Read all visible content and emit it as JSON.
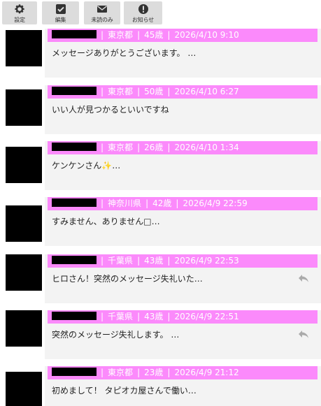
{
  "toolbar": {
    "settings_label": "設定",
    "edit_label": "編集",
    "unread_label": "未読のみ",
    "notice_label": "お知らせ"
  },
  "messages": [
    {
      "prefecture": "東京都",
      "age": "45歳",
      "datetime": "2026/4/10 9:10",
      "preview": "メッセージありがとうございます。 …",
      "reply": false
    },
    {
      "prefecture": "東京都",
      "age": "50歳",
      "datetime": "2026/4/10 6:27",
      "preview": "いい人が見つかるといいですね",
      "reply": false
    },
    {
      "prefecture": "東京都",
      "age": "26歳",
      "datetime": "2026/4/10 1:34",
      "preview": "ケンケンさん✨…",
      "reply": false
    },
    {
      "prefecture": "神奈川県",
      "age": "42歳",
      "datetime": "2026/4/9 22:59",
      "preview": "すみません、ありません□…",
      "reply": false
    },
    {
      "prefecture": "千葉県",
      "age": "43歳",
      "datetime": "2026/4/9 22:53",
      "preview": "ヒロさん！突然のメッセージ失礼いた…",
      "reply": true
    },
    {
      "prefecture": "千葉県",
      "age": "43歳",
      "datetime": "2026/4/9 22:51",
      "preview": "突然のメッセージ失礼します。 …",
      "reply": true
    },
    {
      "prefecture": "東京都",
      "age": "23歳",
      "datetime": "2026/4/9 21:12",
      "preview": "初めまして！ タピオカ屋さんで働い…",
      "reply": false
    }
  ],
  "icons": {
    "settings": "gear-icon",
    "edit": "checkbox-icon",
    "unread": "envelope-icon",
    "notice": "exclamation-icon",
    "reply": "reply-arrow-icon"
  },
  "colors": {
    "header_bg": "#fb8afb",
    "card_bg": "#f3f3f3",
    "toolbar_btn": "#dcdcdc"
  }
}
